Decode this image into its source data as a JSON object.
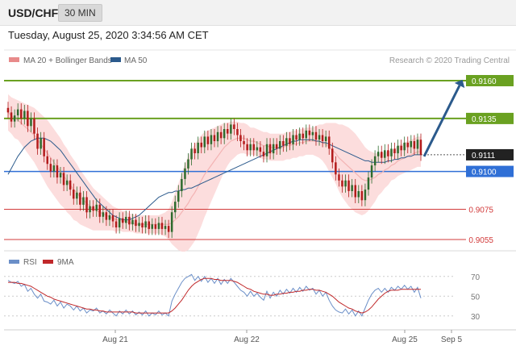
{
  "header": {
    "symbol": "USD/CHF",
    "timeframe": "30 MIN",
    "datetime": "Tuesday, August 25, 2020 3:34:56 AM CET"
  },
  "legend": {
    "ma20": "MA 20 + Bollinger Bands",
    "ma50": "MA 50",
    "ma20_color": "#e88a8a",
    "ma50_color": "#2b5a8c"
  },
  "copyright": "Research © 2020 Trading Central",
  "rsi_legend": {
    "rsi": "RSI",
    "ma9": "9MA",
    "rsi_color": "#6b8fc8",
    "ma9_color": "#c0282a"
  },
  "colors": {
    "green_level": "#6aa121",
    "blue_level": "#2f6fd6",
    "red_level": "#d23b3b",
    "candle_up": "#2e6b2e",
    "candle_down": "#b31b1b",
    "band_fill": "#fcd9d9",
    "arrow": "#2b5a8c",
    "last_price": "#222222"
  },
  "chart_data": [
    {
      "type": "candlestick",
      "price_range": [
        0.9045,
        0.9172
      ],
      "x_ticks": [
        "Aug 21",
        "Aug 22",
        "Aug 25",
        "Sep 5"
      ],
      "levels": [
        {
          "value": 0.916,
          "label": "0.9160",
          "style": "resistance"
        },
        {
          "value": 0.9135,
          "label": "0.9135",
          "style": "resistance"
        },
        {
          "value": 0.9111,
          "label": "0.9111",
          "style": "last"
        },
        {
          "value": 0.91,
          "label": "0.9100",
          "style": "pivot"
        },
        {
          "value": 0.9075,
          "label": "0.9075",
          "style": "support"
        },
        {
          "value": 0.9055,
          "label": "0.9055",
          "style": "support"
        }
      ],
      "close": [
        0.9139,
        0.9133,
        0.9137,
        0.9141,
        0.9135,
        0.914,
        0.913,
        0.9135,
        0.9125,
        0.9115,
        0.9122,
        0.911,
        0.9105,
        0.91,
        0.9104,
        0.9096,
        0.9099,
        0.9091,
        0.9094,
        0.9088,
        0.9082,
        0.9086,
        0.9078,
        0.9083,
        0.9073,
        0.9077,
        0.9074,
        0.9078,
        0.907,
        0.9073,
        0.9068,
        0.9071,
        0.9067,
        0.9063,
        0.9069,
        0.9066,
        0.907,
        0.9065,
        0.9068,
        0.9064,
        0.9066,
        0.9063,
        0.9067,
        0.9062,
        0.9065,
        0.9062,
        0.9066,
        0.9062,
        0.9064,
        0.906,
        0.9073,
        0.908,
        0.9087,
        0.9095,
        0.9102,
        0.9108,
        0.9115,
        0.9112,
        0.9119,
        0.9116,
        0.9123,
        0.9118,
        0.9124,
        0.912,
        0.9126,
        0.9122,
        0.9128,
        0.9125,
        0.9131,
        0.9128,
        0.9124,
        0.912,
        0.9118,
        0.9114,
        0.9118,
        0.9114,
        0.9116,
        0.9113,
        0.911,
        0.9118,
        0.9112,
        0.9118,
        0.9115,
        0.912,
        0.9117,
        0.9122,
        0.9118,
        0.9124,
        0.9121,
        0.9125,
        0.9122,
        0.9127,
        0.9124,
        0.9126,
        0.9121,
        0.9124,
        0.912,
        0.9123,
        0.9115,
        0.9106,
        0.9098,
        0.9094,
        0.909,
        0.9094,
        0.9087,
        0.9091,
        0.9083,
        0.9087,
        0.9081,
        0.9088,
        0.9096,
        0.9104,
        0.911,
        0.9113,
        0.9109,
        0.9114,
        0.911,
        0.9115,
        0.9112,
        0.9117,
        0.9114,
        0.9119,
        0.9116,
        0.912,
        0.9115,
        0.9121,
        0.9111
      ],
      "ma20": [
        0.9139,
        0.9137,
        0.9135,
        0.9134,
        0.9132,
        0.913,
        0.9128,
        0.9126,
        0.9124,
        0.9121,
        0.9118,
        0.9115,
        0.9112,
        0.9109,
        0.9106,
        0.9103,
        0.91,
        0.9097,
        0.9094,
        0.9091,
        0.9088,
        0.9086,
        0.9083,
        0.9081,
        0.9079,
        0.9077,
        0.9075,
        0.9074,
        0.9073,
        0.9072,
        0.9071,
        0.907,
        0.9069,
        0.9068,
        0.9068,
        0.9067,
        0.9067,
        0.9066,
        0.9066,
        0.9065,
        0.9065,
        0.9065,
        0.9065,
        0.9065,
        0.9065,
        0.9065,
        0.9065,
        0.9065,
        0.9065,
        0.9065,
        0.9066,
        0.9068,
        0.907,
        0.9073,
        0.9076,
        0.9079,
        0.9083,
        0.9086,
        0.909,
        0.9094,
        0.9098,
        0.9101,
        0.9104,
        0.9107,
        0.911,
        0.9113,
        0.9116,
        0.9118,
        0.912,
        0.9121,
        0.9122,
        0.9122,
        0.9122,
        0.9121,
        0.912,
        0.912,
        0.9119,
        0.9118,
        0.9117,
        0.9117,
        0.9116,
        0.9116,
        0.9116,
        0.9116,
        0.9116,
        0.9117,
        0.9117,
        0.9118,
        0.9118,
        0.9119,
        0.9119,
        0.912,
        0.912,
        0.912,
        0.912,
        0.912,
        0.9119,
        0.9118,
        0.9116,
        0.9114,
        0.9112,
        0.9109,
        0.9107,
        0.9105,
        0.9103,
        0.9101,
        0.9099,
        0.9097,
        0.9095,
        0.9094,
        0.9094,
        0.9095,
        0.9096,
        0.9098,
        0.9099,
        0.9101,
        0.9102,
        0.9104,
        0.9105,
        0.9107,
        0.9108,
        0.9109,
        0.911,
        0.9111,
        0.9112,
        0.9113,
        0.9113
      ],
      "ma20_band_width": [
        0.0012,
        0.0012,
        0.0013,
        0.0013,
        0.0014,
        0.0015,
        0.0016,
        0.0017,
        0.0018,
        0.0019,
        0.002,
        0.0021,
        0.0022,
        0.0022,
        0.0022,
        0.0022,
        0.0022,
        0.0021,
        0.0021,
        0.002,
        0.002,
        0.0019,
        0.0018,
        0.0017,
        0.0016,
        0.0015,
        0.0014,
        0.0013,
        0.0012,
        0.0011,
        0.001,
        0.0009,
        0.0008,
        0.0008,
        0.0007,
        0.0007,
        0.0007,
        0.0006,
        0.0006,
        0.0006,
        0.0006,
        0.0006,
        0.0006,
        0.0006,
        0.0006,
        0.0006,
        0.0006,
        0.0007,
        0.0008,
        0.001,
        0.0014,
        0.0018,
        0.0022,
        0.0026,
        0.0029,
        0.0031,
        0.0032,
        0.0032,
        0.0031,
        0.003,
        0.0028,
        0.0026,
        0.0024,
        0.0022,
        0.002,
        0.0018,
        0.0016,
        0.0014,
        0.0013,
        0.0012,
        0.0011,
        0.001,
        0.001,
        0.001,
        0.0009,
        0.0009,
        0.0009,
        0.0009,
        0.0009,
        0.0009,
        0.0009,
        0.0009,
        0.0009,
        0.0009,
        0.0009,
        0.0009,
        0.0009,
        0.0009,
        0.0009,
        0.0009,
        0.0009,
        0.0009,
        0.0009,
        0.0009,
        0.001,
        0.0011,
        0.0012,
        0.0014,
        0.0016,
        0.0018,
        0.002,
        0.0022,
        0.0024,
        0.0025,
        0.0026,
        0.0026,
        0.0026,
        0.0025,
        0.0024,
        0.0022,
        0.002,
        0.0018,
        0.0016,
        0.0014,
        0.0013,
        0.0012,
        0.0011,
        0.001,
        0.001,
        0.001,
        0.001,
        0.001,
        0.001,
        0.001,
        0.001,
        0.001,
        0.001
      ],
      "ma50": [
        0.9098,
        0.9102,
        0.9106,
        0.911,
        0.9113,
        0.9116,
        0.9118,
        0.912,
        0.9121,
        0.9122,
        0.9122,
        0.9122,
        0.9121,
        0.912,
        0.9118,
        0.9116,
        0.9114,
        0.9111,
        0.9108,
        0.9105,
        0.9102,
        0.9099,
        0.9096,
        0.9093,
        0.909,
        0.9087,
        0.9084,
        0.9081,
        0.9079,
        0.9077,
        0.9075,
        0.9073,
        0.9071,
        0.907,
        0.9069,
        0.9068,
        0.9068,
        0.9068,
        0.9069,
        0.907,
        0.9071,
        0.9073,
        0.9075,
        0.9077,
        0.9079,
        0.9081,
        0.9083,
        0.9084,
        0.9085,
        0.9086,
        0.9086,
        0.9087,
        0.9087,
        0.9088,
        0.9088,
        0.9089,
        0.9089,
        0.909,
        0.9091,
        0.9092,
        0.9093,
        0.9094,
        0.9095,
        0.9096,
        0.9097,
        0.9098,
        0.9099,
        0.91,
        0.9101,
        0.9102,
        0.9103,
        0.9104,
        0.9105,
        0.9106,
        0.9107,
        0.9108,
        0.9109,
        0.911,
        0.9111,
        0.9112,
        0.9113,
        0.9114,
        0.9115,
        0.9116,
        0.9117,
        0.9118,
        0.9119,
        0.912,
        0.912,
        0.9121,
        0.9121,
        0.9121,
        0.9121,
        0.9121,
        0.912,
        0.912,
        0.9119,
        0.9119,
        0.9118,
        0.9117,
        0.9116,
        0.9115,
        0.9114,
        0.9113,
        0.9112,
        0.9111,
        0.911,
        0.9109,
        0.9108,
        0.9107,
        0.9107,
        0.9106,
        0.9106,
        0.9106,
        0.9106,
        0.9106,
        0.9107,
        0.9107,
        0.9108,
        0.9108,
        0.9109,
        0.9109,
        0.911,
        0.911,
        0.9111,
        0.9111,
        0.9111
      ],
      "projection": {
        "from": 0.9111,
        "to": 0.916
      }
    },
    {
      "type": "line",
      "title": "RSI",
      "y_ticks": [
        70,
        50,
        30
      ],
      "ylim": [
        20,
        78
      ],
      "series": [
        {
          "name": "RSI",
          "values": [
            66,
            64,
            63,
            65,
            60,
            62,
            55,
            58,
            52,
            48,
            52,
            45,
            44,
            42,
            46,
            40,
            44,
            38,
            42,
            40,
            36,
            40,
            35,
            38,
            33,
            36,
            35,
            38,
            33,
            35,
            32,
            36,
            33,
            30,
            35,
            32,
            36,
            32,
            35,
            31,
            34,
            31,
            35,
            30,
            33,
            31,
            35,
            31,
            33,
            30,
            45,
            52,
            58,
            64,
            68,
            70,
            72,
            66,
            70,
            65,
            70,
            64,
            68,
            63,
            68,
            62,
            67,
            63,
            68,
            64,
            60,
            56,
            54,
            50,
            55,
            50,
            53,
            49,
            46,
            55,
            48,
            54,
            50,
            56,
            52,
            57,
            53,
            58,
            54,
            59,
            55,
            60,
            56,
            58,
            52,
            56,
            50,
            54,
            46,
            40,
            36,
            34,
            33,
            37,
            32,
            36,
            30,
            35,
            30,
            38,
            46,
            52,
            56,
            58,
            54,
            58,
            54,
            59,
            56,
            60,
            57,
            61,
            57,
            60,
            54,
            59,
            48
          ]
        },
        {
          "name": "9MA",
          "values": [
            64,
            64,
            64,
            63,
            63,
            62,
            61,
            60,
            58,
            56,
            54,
            52,
            50,
            49,
            47,
            46,
            45,
            44,
            43,
            42,
            41,
            40,
            39,
            38,
            37,
            37,
            36,
            36,
            35,
            35,
            34,
            34,
            34,
            34,
            34,
            34,
            34,
            34,
            34,
            33,
            33,
            33,
            33,
            33,
            33,
            33,
            33,
            33,
            33,
            33,
            35,
            38,
            42,
            46,
            51,
            56,
            60,
            63,
            65,
            67,
            68,
            68,
            68,
            67,
            67,
            66,
            66,
            66,
            66,
            65,
            64,
            62,
            60,
            58,
            57,
            55,
            54,
            53,
            52,
            52,
            51,
            51,
            52,
            52,
            53,
            53,
            54,
            54,
            55,
            55,
            56,
            56,
            57,
            57,
            56,
            56,
            55,
            54,
            52,
            50,
            47,
            44,
            42,
            40,
            38,
            37,
            35,
            34,
            33,
            34,
            36,
            39,
            43,
            47,
            50,
            53,
            55,
            56,
            56,
            56,
            57,
            57,
            57,
            57,
            57,
            57,
            57
          ]
        }
      ]
    }
  ]
}
